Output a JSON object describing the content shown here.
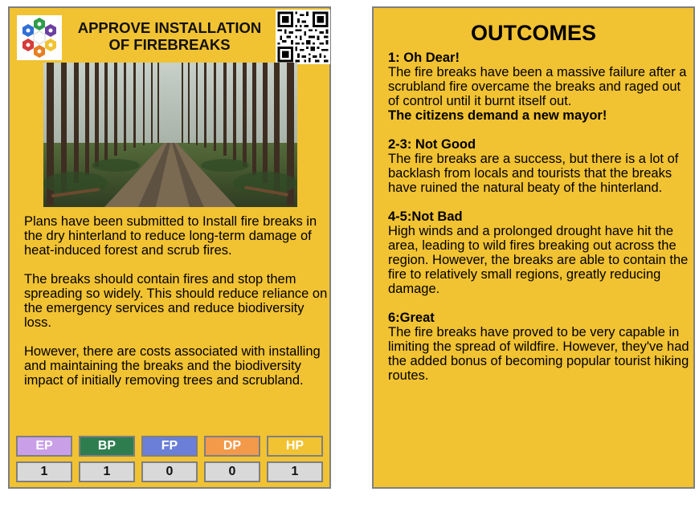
{
  "card": {
    "title": "APPROVE INSTALLATION OF FIREBREAKS",
    "description": [
      "Plans have been submitted to Install fire breaks in the dry hinterland to reduce long-term damage of heat-induced forest and scrub fires.",
      "The breaks should contain fires and stop them spreading so widely. This should reduce reliance on the emergency services and reduce biodiversity loss.",
      "However, there are costs associated with installing and maintaining the breaks and the biodiversity impact of initially removing trees and scrubland."
    ],
    "stats": [
      {
        "label": "EP",
        "value": "1",
        "color": "#c9a0e8"
      },
      {
        "label": "BP",
        "value": "1",
        "color": "#2e7d4f"
      },
      {
        "label": "FP",
        "value": "0",
        "color": "#6b7fd8"
      },
      {
        "label": "DP",
        "value": "0",
        "color": "#f2994a"
      },
      {
        "label": "HP",
        "value": "1",
        "color": "#f1c232"
      }
    ]
  },
  "outcomes": {
    "title": "OUTCOMES",
    "items": [
      {
        "heading": "1: Oh Dear!",
        "body": "The fire breaks have been a massive failure after a scrubland fire overcame the breaks and raged out of control until it burnt itself out.",
        "emphasis": "The citizens demand a new mayor!"
      },
      {
        "heading": "2-3: Not Good",
        "body": "The fire breaks are a success, but there is a lot of backlash from locals and tourists that the breaks have ruined the natural beaty of the hinterland."
      },
      {
        "heading": "4-5:Not Bad",
        "body": "High winds and a prolonged drought have hit the area, leading to wild fires breaking out across the region. However, the breaks are able to contain the fire to relatively small regions, greatly reducing damage."
      },
      {
        "heading": "6:Great",
        "body": "The fire breaks have proved to be very capable in limiting the spread of wildfire. However, they've had the added bonus of becoming popular tourist hiking routes."
      }
    ]
  },
  "colors": {
    "card_background": "#f1c232",
    "border": "#7f7f7f",
    "stat_value_background": "#d9d9d9"
  }
}
